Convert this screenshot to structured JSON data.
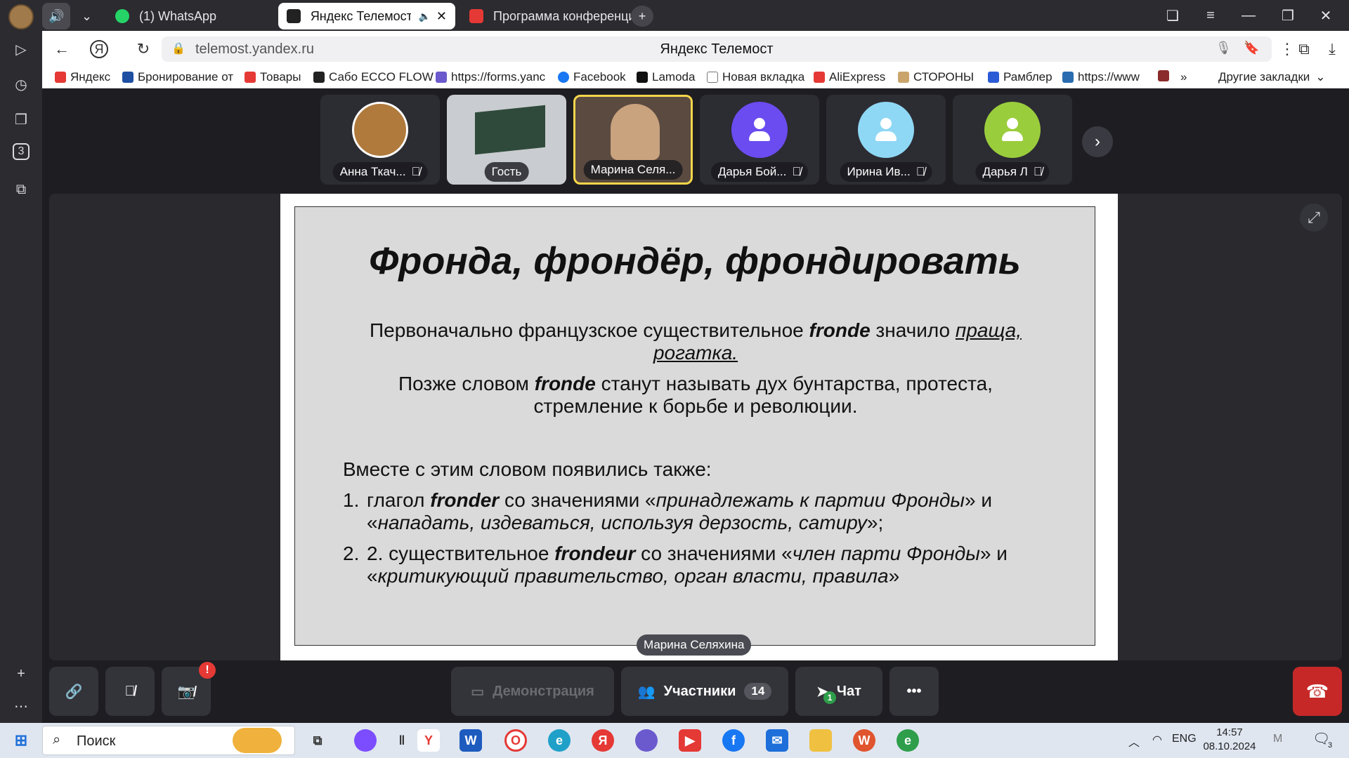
{
  "browser": {
    "tabs": [
      {
        "label": "(1) WhatsApp"
      },
      {
        "label": "Яндекс Телемост"
      },
      {
        "label": "Программа конференци"
      }
    ],
    "url": "telemost.yandex.ru",
    "page_title": "Яндекс Телемост",
    "bookmarks": [
      "Яндекс",
      "Бронирование от",
      "Товары",
      "Сабо ECCO FLOW",
      "https://forms.yanc",
      "Facebook",
      "Lamoda",
      "Новая вкладка",
      "AliExpress",
      "СТОРОНЫ",
      "Рамблер",
      "https://www",
      "»",
      "Другие закладки"
    ],
    "rail_badge": "3"
  },
  "participants": [
    {
      "name": "Анна Ткач...",
      "muted": true
    },
    {
      "name": "Гость",
      "muted": false
    },
    {
      "name": "Марина Селя...",
      "muted": false,
      "speaking": true
    },
    {
      "name": "Дарья Бой...",
      "muted": true,
      "color": "#6b4cf0"
    },
    {
      "name": "Ирина Ив...",
      "muted": true,
      "color": "#8fd8f5"
    },
    {
      "name": "Дарья Л",
      "muted": true,
      "color": "#9acd3c"
    }
  ],
  "slide": {
    "title": "Фронда, фрондёр, фрондировать",
    "p1_a": "Первоначально французское существительное ",
    "p1_b": "fronde",
    "p1_c": " значило ",
    "p1_d": "праща, рогатка.",
    "p2_a": "Позже словом ",
    "p2_b": "fronde",
    "p2_c": " станут называть дух бунтарства, протеста, стремление к борьбе и революции.",
    "intro": "Вместе с этим словом появились также:",
    "li1_num": "1.",
    "li1_a": "глагол ",
    "li1_b": "fronder",
    "li1_c": " со значениями «",
    "li1_d": "принадлежать к партии Фронды",
    "li1_e": "» и «",
    "li1_f": "нападать, издеваться, используя дерзость, сатиру",
    "li1_g": "»;",
    "li2_num": "2.",
    "li2_a": "2. существительное ",
    "li2_b": "frondeur",
    "li2_c": " со значениями «",
    "li2_d": "член парти Фронды",
    "li2_e": "» и «",
    "li2_f": "критикующий правительство, орган власти, правила",
    "li2_g": "»"
  },
  "presenter": "Марина Селяхина",
  "toolbar": {
    "demo": "Демонстрация",
    "participants": "Участники",
    "participants_count": "14",
    "chat": "Чат",
    "chat_unread": "1",
    "camera_alert": "!"
  },
  "taskbar": {
    "search": "Поиск",
    "lang": "ENG",
    "time": "14:57",
    "date": "08.10.2024",
    "notif_count": "3"
  }
}
